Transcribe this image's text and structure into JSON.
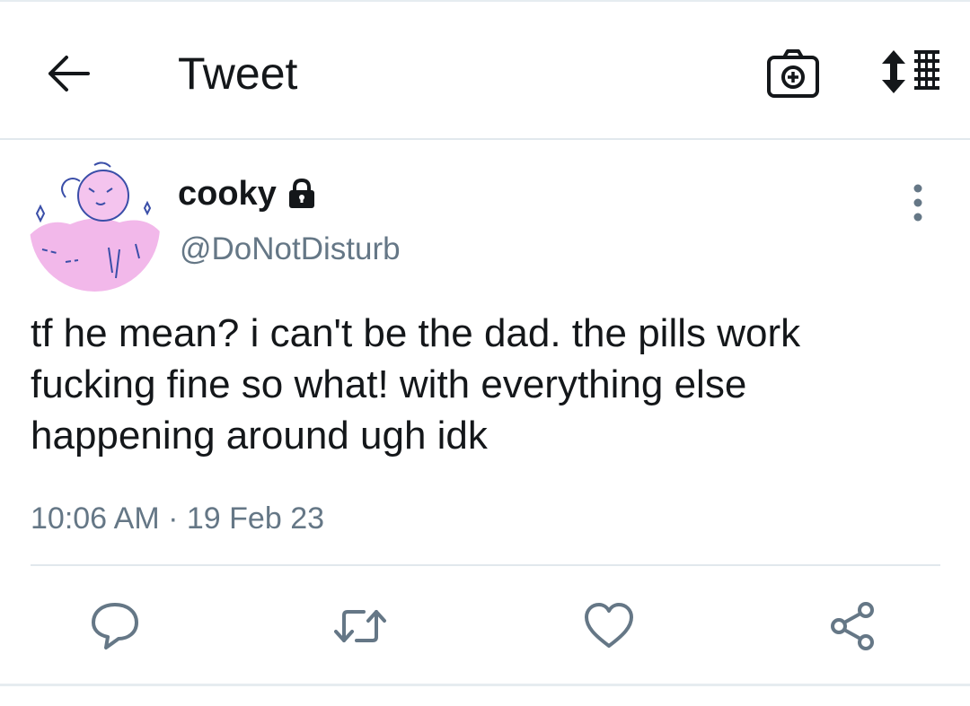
{
  "header": {
    "title": "Tweet",
    "back_icon": "arrow-left-icon",
    "camera_icon": "camera-add-icon",
    "sort_icon": "sort-list-icon"
  },
  "tweet": {
    "display_name": "cooky",
    "protected_icon": "lock-icon",
    "handle": "@DoNotDisturb",
    "text": "tf he mean? i can't be the dad. the pills work\nfucking fine so what! with everything else\nhappening around ugh idk",
    "time": "10:06 AM",
    "separator": "·",
    "date": "19 Feb 23"
  },
  "actions": [
    {
      "name": "reply",
      "icon": "reply-icon"
    },
    {
      "name": "retweet",
      "icon": "retweet-icon"
    },
    {
      "name": "like",
      "icon": "heart-icon"
    },
    {
      "name": "share",
      "icon": "share-icon"
    }
  ],
  "colors": {
    "text": "#14171a",
    "secondary": "#657786",
    "divider": "#e1e8ed",
    "avatar_pink": "#f2b8ea",
    "avatar_outline": "#3a4ea8"
  }
}
